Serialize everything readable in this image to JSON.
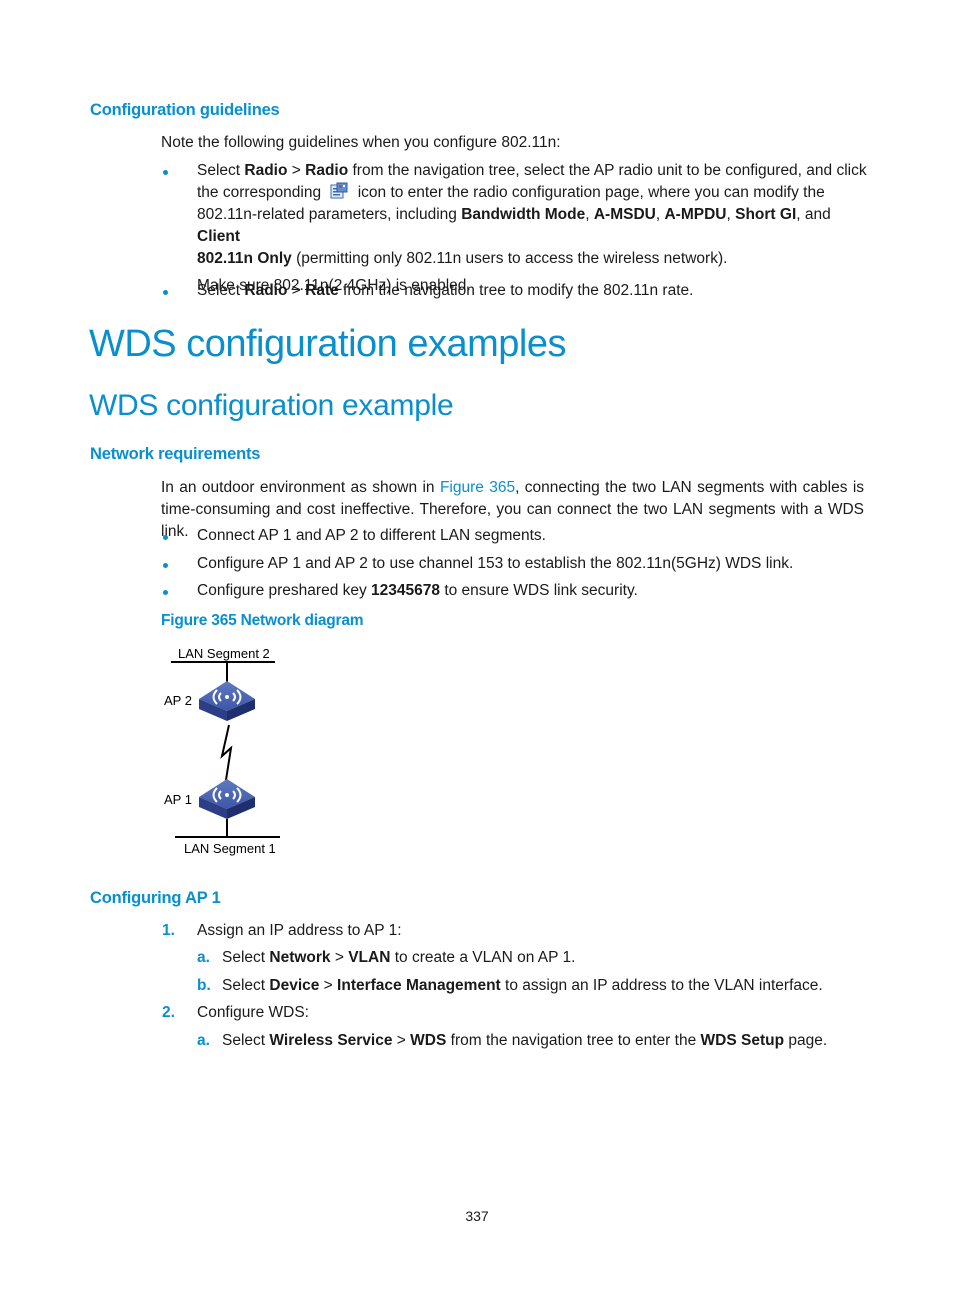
{
  "guidelines": {
    "heading": "Configuration guidelines",
    "intro": "Note the following guidelines when you configure 802.11n:",
    "bullet1": {
      "select": "Select ",
      "radio1": "Radio",
      "gt1": " > ",
      "radio2": "Radio",
      "text1": " from the navigation tree, select the AP radio unit to be configured, and click",
      "text2a": "the corresponding ",
      "icon": "radio-config-icon",
      "text2b": " icon to enter the radio configuration page, where you can modify the",
      "text3": "802.11n-related parameters, including ",
      "bw": "Bandwidth Mode",
      "c1": ", ",
      "amsdu": "A-MSDU",
      "c2": ", ",
      "ampdu": "A-MPDU",
      "c3": ", ",
      "sgi": "Short GI",
      "c4": ", and ",
      "client": "Client",
      "client2": "802.11n Only",
      "text4": " (permitting only 802.11n users to access the wireless network).",
      "note": "Make sure 802.11n(2.4GHz) is enabled."
    },
    "bullet2": {
      "select": "Select ",
      "radio": "Radio",
      "gt": " > ",
      "rate": "Rate",
      "text": " from the navigation tree to modify the 802.11n rate."
    }
  },
  "chapter_title": "WDS configuration examples",
  "section_title": "WDS configuration example",
  "network_requirements": {
    "heading": "Network requirements",
    "para_a": "In an outdoor environment as shown in ",
    "para_link": "Figure 365",
    "para_b": ", connecting the two LAN segments with cables is",
    "para_c": "time-consuming and cost ineffective. Therefore, you can connect the two LAN segments with a WDS link.",
    "bullets": [
      "Connect AP 1 and AP 2 to different LAN segments.",
      "Configure AP 1 and AP 2 to use channel 153 to establish the 802.11n(5GHz) WDS link."
    ],
    "bullet3_a": "Configure preshared key ",
    "bullet3_key": "12345678",
    "bullet3_b": " to ensure WDS link security.",
    "figure_caption": "Figure 365 Network diagram"
  },
  "diagram": {
    "lan2": "LAN Segment 2",
    "ap2": "AP 2",
    "ap1": "AP 1",
    "lan1": "LAN Segment 1",
    "device_color": "#3d56a6"
  },
  "configuring_ap1": {
    "heading": "Configuring AP 1",
    "step1_num": "1.",
    "step1": "Assign an IP address to AP 1:",
    "s1a_label": "a.",
    "s1a_select": "Select ",
    "s1a_b1": "Network",
    "s1a_gt": " > ",
    "s1a_b2": "VLAN",
    "s1a_text": " to create a VLAN on AP 1.",
    "s1b_label": "b.",
    "s1b_select": "Select ",
    "s1b_b1": "Device",
    "s1b_gt": " > ",
    "s1b_b2": "Interface Management",
    "s1b_text": " to assign an IP address to the VLAN interface.",
    "step2_num": "2.",
    "step2": "Configure WDS:",
    "s2a_label": "a.",
    "s2a_select": "Select ",
    "s2a_b1": "Wireless Service",
    "s2a_gt": " > ",
    "s2a_b2": "WDS",
    "s2a_text": " from the navigation tree to enter the ",
    "s2a_b3": "WDS Setup",
    "s2a_end": " page."
  },
  "page_number": "337"
}
